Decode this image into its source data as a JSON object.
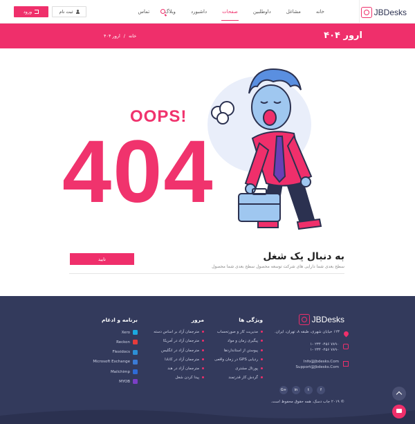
{
  "header": {
    "logo_text": "JBDesks",
    "nav": [
      "خانه",
      "مشاغل",
      "داوطلبین",
      "صفحات",
      "داشبورد",
      "وبلاگ",
      "تماس"
    ],
    "active_nav_index": 3,
    "register_label": "ثبت نام",
    "login_label": "ورود"
  },
  "title_band": {
    "title": "ارور ۴۰۴",
    "breadcrumb": [
      "خانه",
      "/",
      "ارور ۴۰۴"
    ]
  },
  "illustration": {
    "big_text": "404",
    "oops_text": "OOPS!"
  },
  "job_search": {
    "title": "به دنبال یک شغل",
    "description": "سطح بعدی شما دارایی های شرکت توسعه محصول سطح بعدی شما محصول",
    "button_label": "تایید"
  },
  "footer": {
    "logo_text": "JBDesks",
    "address": "۱۲۳ خیابان شهری، طبقه ۸، تهران، ایران.",
    "phones": [
      "۷۸۹۰ ۴۵۶- ۲۳۴ -۱",
      "۷۸۹۰ ۴۵۶- ۲۳۴ -۱"
    ],
    "emails": [
      "Info@Jbdesks.Com",
      "Support@Jbdesks.Com"
    ],
    "features": {
      "title": "ویژگی ها",
      "items": [
        "مدیریت کار و صورتحساب",
        "پیگیری زمان و مواد",
        "پیوستن از استانداردها",
        "ردیابی GPS در زمان واقعی",
        "پورتال مشتری",
        "گردش کار قدرتمند"
      ]
    },
    "browse": {
      "title": "مرور",
      "items": [
        "مترجمان آزاد بر اساس دسته",
        "مترجمان آزاد در آمریکا",
        "مترجمان آزاد در انگلیس",
        "مترجمان آزاد در کانادا",
        "مترجمان آزاد در هند",
        "پیدا کردن شغل"
      ]
    },
    "apps": {
      "title": "برنامه و ادغام",
      "items": [
        {
          "name": "Xero",
          "color": "#1aa9e0"
        },
        {
          "name": "Reckon",
          "color": "#e53b3b"
        },
        {
          "name": "Flexidocs",
          "color": "#2c8fd6"
        },
        {
          "name": "Microsoft Exchange",
          "color": "#3b7bd6"
        },
        {
          "name": "Mailchimp",
          "color": "#2e6bd6"
        },
        {
          "name": "MYOB",
          "color": "#7b3fc6"
        }
      ]
    },
    "social": [
      "G+",
      "in",
      "t",
      "f"
    ],
    "copyright": "© ۲۰۱۹ جاب دسک. همه حقوق محفوظ است."
  },
  "colors": {
    "accent": "#ef2f6b",
    "footer_bg": "#333a5c"
  }
}
